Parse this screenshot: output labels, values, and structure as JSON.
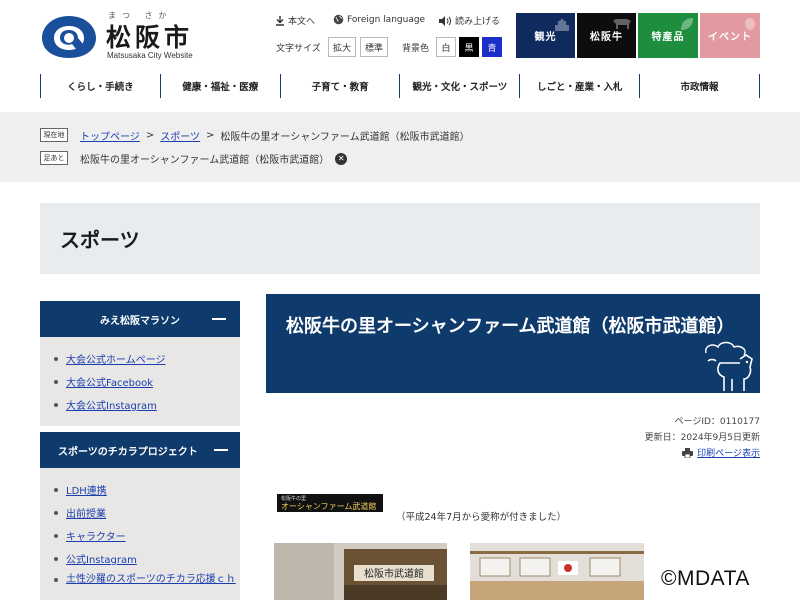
{
  "header": {
    "logo_ruby": "まつ さか",
    "logo_title": "松阪市",
    "logo_sub": "Matsusaka City Website",
    "skip_label": "本文へ",
    "lang_label": "Foreign language",
    "read_label": "読み上げる",
    "text_size_label": "文字サイズ",
    "size_large": "拡大",
    "size_std": "標準",
    "bg_label": "背景色",
    "bg_white": "白",
    "bg_black": "黒",
    "bg_blue": "青",
    "categories": [
      {
        "label": "観光",
        "color": "#0f2a5c"
      },
      {
        "label": "松阪牛",
        "color": "#0d0d0d"
      },
      {
        "label": "特産品",
        "color": "#1e8e3e"
      },
      {
        "label": "イベント",
        "color": "#e29aa0"
      }
    ]
  },
  "nav": [
    "くらし・手続き",
    "健康・福祉・医療",
    "子育て・教育",
    "観光・文化・スポーツ",
    "しごと・産業・入札",
    "市政情報"
  ],
  "breadcrumb": {
    "current_tag": "現在地",
    "trail_tag": "足あと",
    "home": "トップページ",
    "sep": ">",
    "section": "スポーツ",
    "current": "松阪牛の里オーシャンファーム武道館（松阪市武道館）",
    "trail_item": "松阪牛の里オーシャンファーム武道館（松阪市武道館）",
    "close_glyph": "✕"
  },
  "category_title": "スポーツ",
  "sidebar": [
    {
      "title": "みえ松阪マラソン",
      "items": [
        "大会公式ホームページ",
        "大会公式Facebook",
        "大会公式Instagram"
      ]
    },
    {
      "title": "スポーツのチカラプロジェクト",
      "items": [
        "LDH連携",
        "出前授業",
        "キャラクター",
        "公式Instagram",
        "土性沙羅のスポーツのチカラ応援ｃｈ"
      ]
    }
  ],
  "main": {
    "title": "松阪牛の里オーシャンファーム武道館（松阪市武道館）",
    "page_id": "ページID：0110177",
    "updated": "更新日：2024年9月5日更新",
    "print_label": "印刷ページ表示",
    "nickname_logo_top": "松阪牛の里",
    "nickname_logo_main": "オーシャンファーム武道館",
    "nickname_note": "（平成24年7月から愛称が付きました）",
    "photo_sign": "松阪市武道館"
  },
  "watermark": "©MDATA"
}
